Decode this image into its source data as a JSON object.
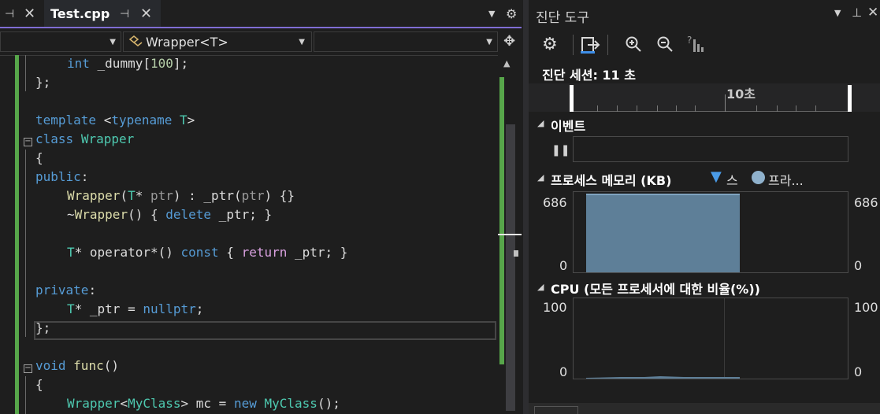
{
  "editor": {
    "tabs": [
      {
        "label": "Test.cpp",
        "active": true
      }
    ],
    "nav": {
      "member_dropdown": "Wrapper<T>"
    },
    "code_lines": [
      {
        "indent": 1,
        "tokens": [
          [
            "kw",
            "int"
          ],
          [
            "pl",
            " _dummy["
          ],
          [
            "nm",
            "100"
          ],
          [
            "pl",
            "];"
          ]
        ]
      },
      {
        "indent": 0,
        "tokens": [
          [
            "pl",
            "};"
          ]
        ]
      },
      {
        "indent": 0,
        "tokens": []
      },
      {
        "indent": 0,
        "tokens": [
          [
            "kw",
            "template"
          ],
          [
            "pl",
            " <"
          ],
          [
            "kw",
            "typename"
          ],
          [
            "pl",
            " "
          ],
          [
            "ty",
            "T"
          ],
          [
            "pl",
            ">"
          ]
        ]
      },
      {
        "indent": 0,
        "tokens": [
          [
            "kw",
            "class"
          ],
          [
            "pl",
            " "
          ],
          [
            "ty",
            "Wrapper"
          ]
        ]
      },
      {
        "indent": 0,
        "tokens": [
          [
            "pl",
            "{"
          ]
        ]
      },
      {
        "indent": 0,
        "tokens": [
          [
            "kw",
            "public"
          ],
          [
            "pl",
            ":"
          ]
        ]
      },
      {
        "indent": 1,
        "tokens": [
          [
            "fn",
            "Wrapper"
          ],
          [
            "pl",
            "("
          ],
          [
            "ty",
            "T"
          ],
          [
            "pl",
            "* "
          ],
          [
            "gray",
            "ptr"
          ],
          [
            "pl",
            ") : _ptr("
          ],
          [
            "gray",
            "ptr"
          ],
          [
            "pl",
            ") {}"
          ]
        ]
      },
      {
        "indent": 1,
        "tokens": [
          [
            "pl",
            "~"
          ],
          [
            "fn",
            "Wrapper"
          ],
          [
            "pl",
            "() { "
          ],
          [
            "kw",
            "delete"
          ],
          [
            "pl",
            " _ptr; }"
          ]
        ]
      },
      {
        "indent": 0,
        "tokens": []
      },
      {
        "indent": 1,
        "tokens": [
          [
            "ty",
            "T"
          ],
          [
            "pl",
            "* operator*() "
          ],
          [
            "kw",
            "const"
          ],
          [
            "pl",
            " { "
          ],
          [
            "ctl",
            "return"
          ],
          [
            "pl",
            " _ptr; }"
          ]
        ]
      },
      {
        "indent": 0,
        "tokens": []
      },
      {
        "indent": 0,
        "tokens": [
          [
            "kw",
            "private"
          ],
          [
            "pl",
            ":"
          ]
        ]
      },
      {
        "indent": 1,
        "tokens": [
          [
            "ty",
            "T"
          ],
          [
            "pl",
            "* _ptr = "
          ],
          [
            "kw",
            "nullptr"
          ],
          [
            "pl",
            ";"
          ]
        ]
      },
      {
        "indent": 0,
        "tokens": [
          [
            "pl",
            "};"
          ]
        ]
      },
      {
        "indent": 0,
        "tokens": []
      },
      {
        "indent": 0,
        "tokens": [
          [
            "kw",
            "void"
          ],
          [
            "pl",
            " "
          ],
          [
            "fn",
            "func"
          ],
          [
            "pl",
            "()"
          ]
        ]
      },
      {
        "indent": 0,
        "tokens": [
          [
            "pl",
            "{"
          ]
        ]
      },
      {
        "indent": 1,
        "tokens": [
          [
            "ty",
            "Wrapper"
          ],
          [
            "pl",
            "<"
          ],
          [
            "ty",
            "MyClass"
          ],
          [
            "pl",
            "> mc = "
          ],
          [
            "kw",
            "new"
          ],
          [
            "pl",
            " "
          ],
          [
            "ty",
            "MyClass"
          ],
          [
            "pl",
            "();"
          ]
        ]
      }
    ]
  },
  "diagnostics": {
    "title": "진단 도구",
    "session_label": "진단 세션: 11 초",
    "timeline_tick": "10초",
    "events_header": "이벤트",
    "memory_header": "프로세스 메모리 (KB)",
    "memory_legend": [
      "스",
      "프라..."
    ],
    "memory_axis": {
      "max": "686",
      "min": "0"
    },
    "cpu_header": "CPU (모든 프로세서에 대한 비율(%))",
    "cpu_axis": {
      "max": "100",
      "min": "0"
    },
    "memory_fill_level": 0.96,
    "colors": {
      "accent": "#7f6dd4",
      "memory_fill": "#5e7f98",
      "change_bar": "#57a64a"
    }
  }
}
